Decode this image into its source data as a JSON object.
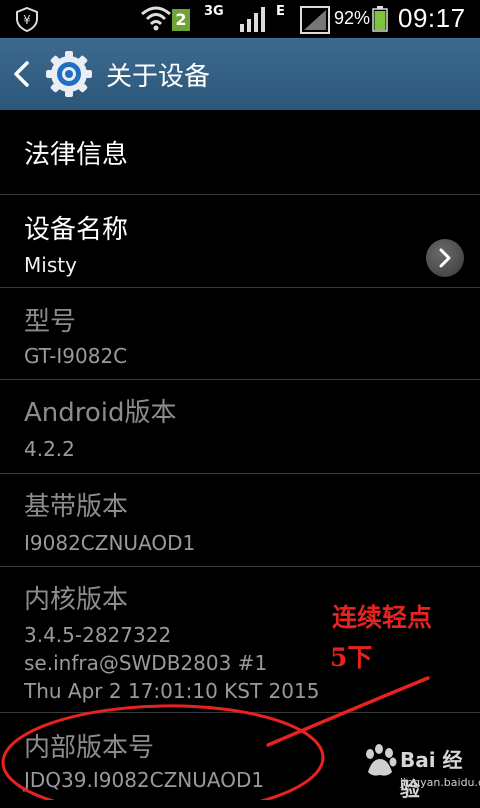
{
  "status_bar": {
    "notification_badge": "2",
    "network_3g": "3G",
    "network_e": "E",
    "battery_percent": "92%",
    "time": "09:17"
  },
  "action_bar": {
    "title": "关于设备"
  },
  "items": [
    {
      "title": "法律信息",
      "subtitle": ""
    },
    {
      "title": "设备名称",
      "subtitle": "Misty"
    },
    {
      "title": "型号",
      "subtitle": "GT-I9082C"
    },
    {
      "title": "Android版本",
      "subtitle": "4.2.2"
    },
    {
      "title": "基带版本",
      "subtitle": "I9082CZNUAOD1"
    },
    {
      "title": "内核版本",
      "subtitle": "3.4.5-2827322\nse.infra@SWDB2803 #1\nThu Apr 2 17:01:10 KST 2015"
    },
    {
      "title": "内部版本号",
      "subtitle": "JDQ39.I9082CZNUAOD1"
    }
  ],
  "annotation": {
    "line1": "连续轻点",
    "line2": "5下",
    "color": "#e8231f"
  },
  "watermark": {
    "brand": "Bai 经验",
    "url": "jingyan.baidu.com"
  },
  "colors": {
    "action_bar": "#2f5b80",
    "enabled_text": "#ffffff",
    "disabled_text": "#8c8c8c"
  }
}
